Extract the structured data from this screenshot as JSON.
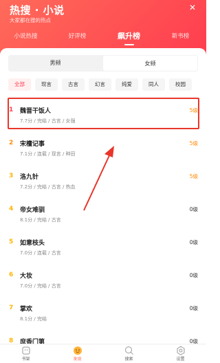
{
  "header": {
    "title": "热搜 · 小说",
    "subtitle": "大家都在搜的热点",
    "close_label": "✕"
  },
  "tabs": [
    {
      "label": "小说热搜",
      "active": false
    },
    {
      "label": "好评榜",
      "active": false
    },
    {
      "label": "飙升榜",
      "active": true
    },
    {
      "label": "新书榜",
      "active": false
    }
  ],
  "segment": {
    "male": "男频",
    "female": "女频"
  },
  "categories": [
    "全部",
    "现言",
    "古言",
    "幻言",
    "纯爱",
    "同人",
    "校园"
  ],
  "books": [
    {
      "rank": "1",
      "title": "魏晋干饭人",
      "meta": "7.7分 / 完结 / 古言 / 女强",
      "level": "5级",
      "rank_color": "#ff3d4f",
      "level_color": "#ff8a00"
    },
    {
      "rank": "2",
      "title": "宋檀记事",
      "meta": "7.1分 / 连载 / 现言 / 种田",
      "level": "5级",
      "rank_color": "#ff8a00",
      "level_color": "#ff8a00"
    },
    {
      "rank": "3",
      "title": "洛九针",
      "meta": "7.2分 / 完结 / 古言 / 热血",
      "level": "5级",
      "rank_color": "#ffb400",
      "level_color": "#ff8a00"
    },
    {
      "rank": "4",
      "title": "帝女难驯",
      "meta": "8.1分 / 完结 / 古言",
      "level": "0级",
      "rank_color": "#ffb400",
      "level_color": "#333333"
    },
    {
      "rank": "5",
      "title": "如意枝头",
      "meta": "7.0分 / 连载 / 古言",
      "level": "0级",
      "rank_color": "#ffb400",
      "level_color": "#333333"
    },
    {
      "rank": "6",
      "title": "大妆",
      "meta": "7.0分 / 完结 / 古言",
      "level": "0级",
      "rank_color": "#ffb400",
      "level_color": "#333333"
    },
    {
      "rank": "7",
      "title": "掌欢",
      "meta": "8.1分 / 完结",
      "level": "0级",
      "rank_color": "#ffb400",
      "level_color": "#333333"
    },
    {
      "rank": "8",
      "title": "庶香门第",
      "meta": "",
      "level": "0级",
      "rank_color": "#ffb400",
      "level_color": "#333333"
    }
  ],
  "bottom_nav": [
    {
      "label": "书架",
      "icon": "bookshelf-icon",
      "active": false
    },
    {
      "label": "发现",
      "icon": "discover-icon",
      "active": true
    },
    {
      "label": "搜索",
      "icon": "search-icon",
      "active": false
    },
    {
      "label": "设置",
      "icon": "settings-icon",
      "active": false
    }
  ],
  "colors": {
    "accent": "#ff3d4f",
    "header_start": "#ff6b5a",
    "highlight": "#e8362b"
  }
}
